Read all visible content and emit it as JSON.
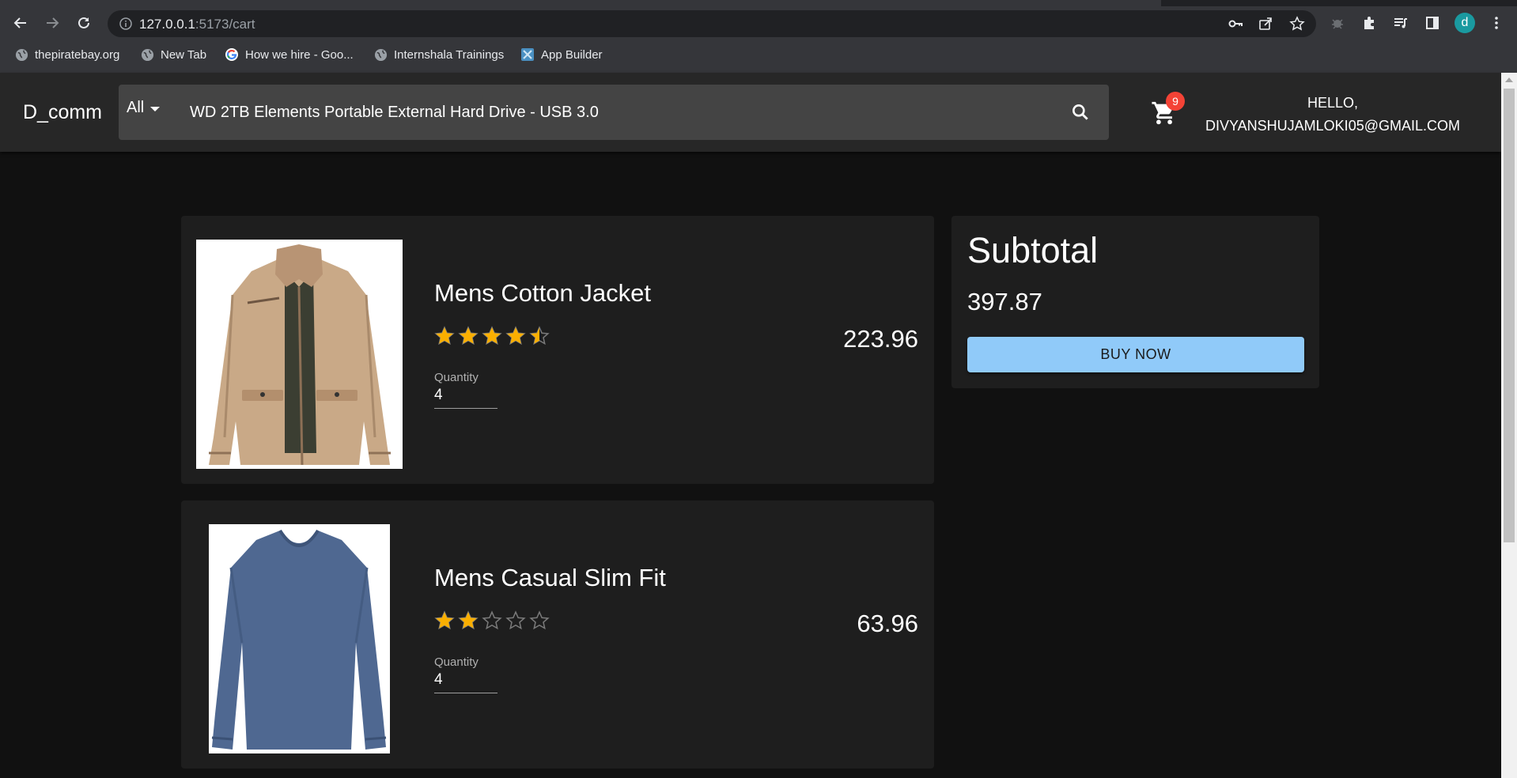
{
  "browser": {
    "url_host": "127.0.0.1",
    "url_path": ":5173/cart",
    "profile_initial": "d",
    "bookmarks": [
      {
        "label": "thepiratebay.org",
        "icon": "globe-icon"
      },
      {
        "label": "New Tab",
        "icon": "globe-icon"
      },
      {
        "label": "How we hire - Goo...",
        "icon": "google-icon"
      },
      {
        "label": "Internshala Trainings",
        "icon": "globe-icon"
      },
      {
        "label": "App Builder",
        "icon": "app-builder-icon"
      }
    ]
  },
  "header": {
    "brand": "D_comm",
    "category": "All",
    "search_value": "WD 2TB Elements Portable External Hard Drive - USB 3.0",
    "cart_count": "9",
    "greeting_line1": "HELLO,",
    "greeting_line2": "DIVYANSHUJAMLOKI05@GMAIL.COM"
  },
  "cart": {
    "items": [
      {
        "title": "Mens Cotton Jacket",
        "rating": 4.5,
        "price": "223.96",
        "quantity_label": "Quantity",
        "quantity": "4",
        "image": "khaki jacket"
      },
      {
        "title": "Mens Casual Slim Fit",
        "rating": 2,
        "price": "63.96",
        "quantity_label": "Quantity",
        "quantity": "4",
        "image": "blue long sleeve shirt"
      }
    ]
  },
  "summary": {
    "title": "Subtotal",
    "total": "397.87",
    "buy_label": "BUY NOW"
  },
  "colors": {
    "page_bg": "#111111",
    "appbar_bg": "#272727",
    "card_bg": "#1e1e1e",
    "star": "#faaf00",
    "buy_button": "#90caf9",
    "badge": "#f44336"
  }
}
